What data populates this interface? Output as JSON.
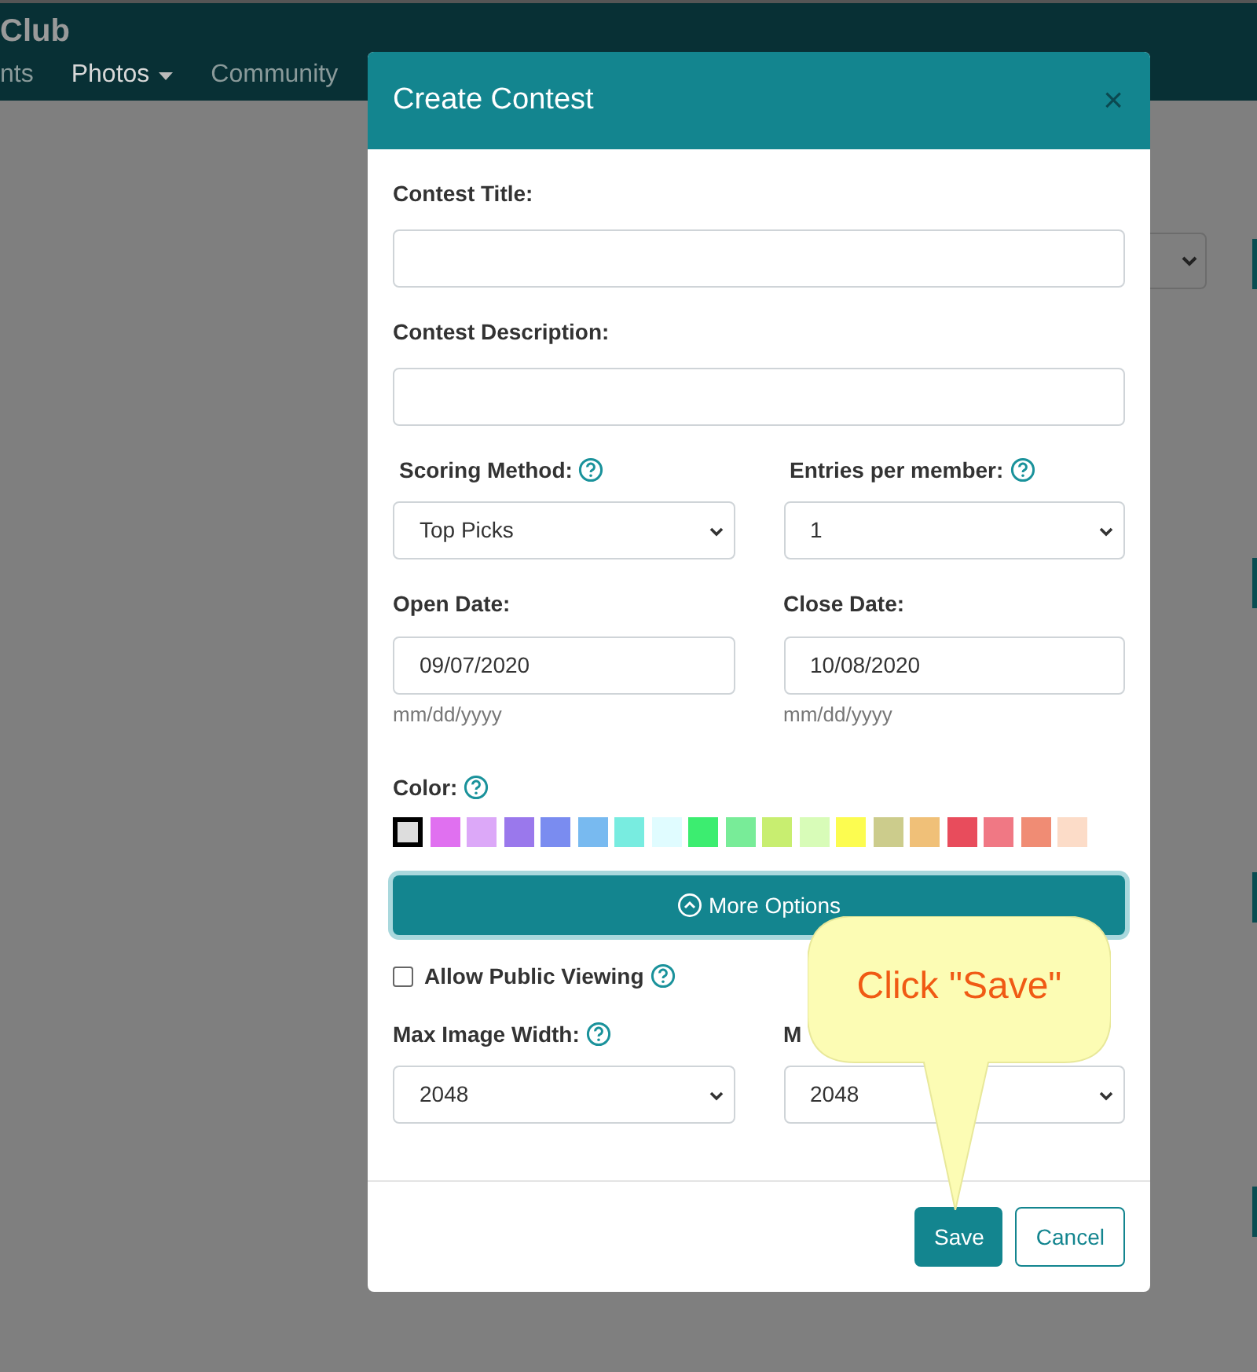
{
  "navbar": {
    "brand": "Club",
    "items": [
      {
        "label": "nts",
        "dropdown": false,
        "selected": false
      },
      {
        "label": "Photos",
        "dropdown": true,
        "selected": true
      },
      {
        "label": "Community",
        "dropdown": false,
        "selected": false
      }
    ]
  },
  "modal": {
    "title": "Create Contest",
    "close": "×",
    "rows": [
      {
        "fields": [
          {
            "kind": "text",
            "label": "Contest Title:",
            "help": false
          }
        ]
      },
      {
        "fields": [
          {
            "kind": "text",
            "label": "Contest Description:",
            "help": false
          }
        ]
      },
      {
        "fields": [
          {
            "kind": "select",
            "label": "Scoring Method:",
            "help": true,
            "value": "Top Picks"
          },
          {
            "kind": "select",
            "label": "Entries per member:",
            "help": true,
            "value": "1"
          }
        ]
      },
      {
        "fields": [
          {
            "kind": "date",
            "label": "Open Date:",
            "help": false,
            "value": "09/07/2020",
            "hint": "mm/dd/yyyy"
          },
          {
            "kind": "date",
            "label": "Close Date:",
            "help": false,
            "value": "10/08/2020",
            "hint": "mm/dd/yyyy"
          }
        ]
      },
      {
        "fields": [
          {
            "kind": "colors",
            "label": "Color:",
            "help": true,
            "swatches": [
              {
                "color": "#dddddd",
                "selected": true
              },
              {
                "color": "#e070f0",
                "selected": false
              },
              {
                "color": "#dca8f8",
                "selected": false
              },
              {
                "color": "#9a78ec",
                "selected": false
              },
              {
                "color": "#7a8cf0",
                "selected": false
              },
              {
                "color": "#78baf0",
                "selected": false
              },
              {
                "color": "#78ece0",
                "selected": false
              },
              {
                "color": "#e0fcff",
                "selected": false
              },
              {
                "color": "#3ced70",
                "selected": false
              },
              {
                "color": "#78ec98",
                "selected": false
              },
              {
                "color": "#c8ee70",
                "selected": false
              },
              {
                "color": "#d8fcb8",
                "selected": false
              },
              {
                "color": "#fcfc50",
                "selected": false
              },
              {
                "color": "#cccc8c",
                "selected": false
              },
              {
                "color": "#f0c078",
                "selected": false
              },
              {
                "color": "#e84c5c",
                "selected": false
              },
              {
                "color": "#f07884",
                "selected": false
              },
              {
                "color": "#f08c74",
                "selected": false
              },
              {
                "color": "#fcdcc8",
                "selected": false
              }
            ]
          }
        ]
      },
      {
        "fields": [
          {
            "kind": "button",
            "label": "More Options",
            "expanded": true
          }
        ]
      },
      {
        "fields": [
          {
            "kind": "checkbox",
            "label": "Allow Public Viewing",
            "help": true,
            "checked": false
          }
        ]
      },
      {
        "fields": [
          {
            "kind": "select",
            "label": "Max Image Width:",
            "help": true,
            "value": "2048"
          },
          {
            "kind": "select",
            "label": "M",
            "help": false,
            "value": "2048"
          }
        ]
      }
    ],
    "buttons": [
      {
        "label": "Save",
        "kind": "primary"
      },
      {
        "label": "Cancel",
        "kind": "outline"
      }
    ]
  },
  "callout": {
    "text": "Click \"Save\""
  }
}
